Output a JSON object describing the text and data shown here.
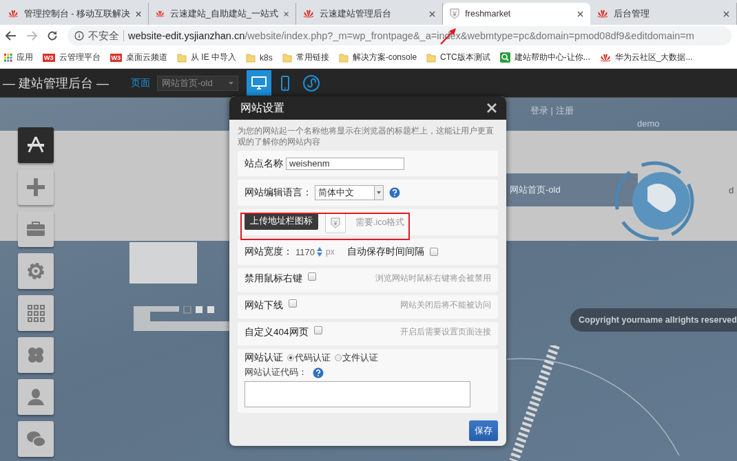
{
  "browser": {
    "tabs": [
      {
        "label": "管理控制台 - 移动互联解决",
        "kind": "huawei",
        "selected": false
      },
      {
        "label": "云速建站_自助建站_一站式",
        "kind": "huawei",
        "selected": false
      },
      {
        "label": "云速建站管理后台",
        "kind": "huawei",
        "selected": false
      },
      {
        "label": "freshmarket",
        "kind": "site",
        "selected": true
      },
      {
        "label": "后台管理",
        "kind": "huawei",
        "selected": false
      }
    ],
    "address": {
      "security": "不安全",
      "host": "website-edit.ysjianzhan.cn",
      "path": "/website/index.php?_m=wp_frontpage&_a=index&webmtype=pc&domain=pmod08df9&editdomain=m"
    },
    "bookmarks": [
      {
        "label": "应用",
        "kind": "apps"
      },
      {
        "label": "云管理平台",
        "kind": "w3",
        "badge": "W3"
      },
      {
        "label": "桌面云频道",
        "kind": "w3",
        "badge": "W3"
      },
      {
        "label": "从 IE 中导入",
        "kind": "folder"
      },
      {
        "label": "k8s",
        "kind": "folder"
      },
      {
        "label": "常用链接",
        "kind": "folder"
      },
      {
        "label": "解决方案-console",
        "kind": "folder"
      },
      {
        "label": "CTC版本测试",
        "kind": "folder"
      },
      {
        "label": "建站帮助中心-让你...",
        "kind": "search"
      },
      {
        "label": "华为云社区_大数据...",
        "kind": "huawei"
      }
    ]
  },
  "app_header": {
    "title": "— 建站管理后台 —",
    "page_label": "页面",
    "page_select": "网站首页-old",
    "devices": [
      {
        "kind": "desktop",
        "selected": true
      },
      {
        "kind": "mobile",
        "selected": false
      },
      {
        "kind": "miniapp",
        "selected": false
      }
    ]
  },
  "sidebar": {
    "tools": [
      {
        "kind": "design",
        "selected": true
      },
      {
        "kind": "add",
        "selected": false
      },
      {
        "kind": "toolbox",
        "selected": false
      },
      {
        "kind": "settings",
        "selected": false
      },
      {
        "kind": "grid",
        "selected": false
      },
      {
        "kind": "clover",
        "selected": false
      },
      {
        "kind": "user",
        "selected": false
      },
      {
        "kind": "chat",
        "selected": false
      }
    ]
  },
  "page_preview": {
    "login_links": "登录 | 注册",
    "site_name": "demo",
    "nav_item": "网站首页-old",
    "nav_item_cut": "d",
    "copyright": "Copyright yourname allrights reserved"
  },
  "dialog": {
    "title": "网站设置",
    "description": "为您的网站起一个名称他将显示在浏览器的标题栏上，这能让用户更直观的了解你的网站内容",
    "site_name": {
      "label": "站点名称",
      "value": "weishenm"
    },
    "language": {
      "label": "网站编辑语言：",
      "value": "简体中文"
    },
    "upload": {
      "button": "上传地址栏图标",
      "hint": "需要.ico格式"
    },
    "width": {
      "label": "网站宽度：",
      "value": "1170",
      "unit": "px"
    },
    "autosave": {
      "label": "自动保存时间间隔",
      "checked": false
    },
    "toggles": [
      {
        "label": "禁用鼠标右键",
        "checked": false,
        "hint": "浏览网站时鼠标右键将会被禁用"
      },
      {
        "label": "网站下线",
        "checked": false,
        "hint": "网站关闭后将不能被访问"
      },
      {
        "label": "自定义404网页",
        "checked": false,
        "hint": "开启后需要设置页面连接"
      }
    ],
    "verification": {
      "label": "网站认证",
      "options": [
        {
          "label": "代码认证",
          "selected": true
        },
        {
          "label": "文件认证",
          "selected": false
        }
      ],
      "code_label": "网站认证代码："
    },
    "save_button": "保存"
  }
}
